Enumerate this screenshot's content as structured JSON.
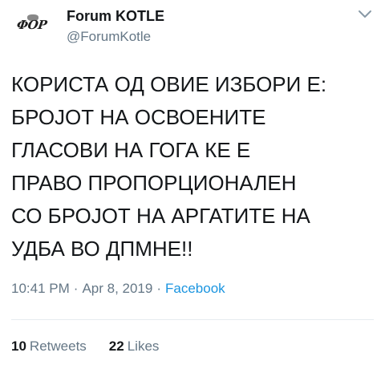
{
  "author": {
    "name": "Forum KOTLE",
    "handle": "@ForumKotle",
    "avatar_text": "ФОР"
  },
  "tweet": {
    "text": "КОРИСТА ОД ОВИЕ ИЗБОРИ Е:\nБРОЈОТ НА ОСВОЕНИТЕ\nГЛАСОВИ НА ГОГА КЕ Е\nПРАВО ПРОПОРЦИОНАЛЕН\nСО БРОЈОТ НА АРГАТИТЕ НА\nУДБА ВО ДПМНЕ!!",
    "time": "10:41 PM",
    "date": "Apr 8, 2019",
    "source": "Facebook",
    "separator": "·"
  },
  "stats": {
    "retweets_count": "10",
    "retweets_label": "Retweets",
    "likes_count": "22",
    "likes_label": "Likes"
  },
  "icons": {
    "menu": "chevron-down-icon"
  },
  "colors": {
    "text": "#14171a",
    "secondary": "#657786",
    "link": "#1b95e0"
  }
}
